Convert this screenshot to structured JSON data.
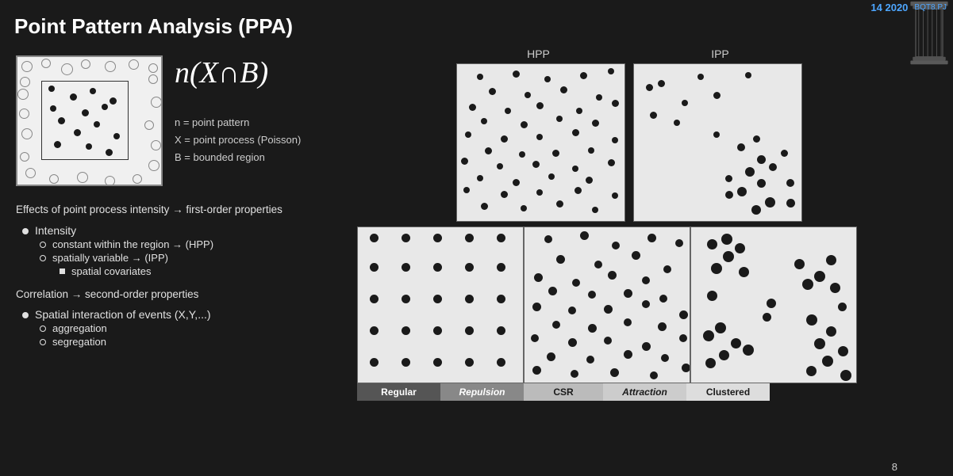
{
  "title": "Point Pattern Analysis (PPA)",
  "topbar": {
    "date": "14  2020",
    "subtitle": "BQT8.PJ"
  },
  "formula": {
    "text": "n(X∩B)",
    "definitions": [
      "n = point pattern",
      "X = point process (Poisson)",
      "B = bounded region"
    ]
  },
  "content": {
    "section1_heading": "Effects of point process intensity → first-order properties",
    "bullet1_label": "Intensity",
    "bullet1_sub1": "constant within the region → (HPP)",
    "bullet1_sub2": "spatially variable → (IPP)",
    "bullet1_sub2_sub1": "spatial covariates",
    "section2_heading": "Correlation → second-order properties",
    "bullet2_label": "Spatial interaction of events (X,Y,...)",
    "bullet2_sub1": "aggregation",
    "bullet2_sub2": "segregation"
  },
  "image_labels": {
    "hpp": "HPP",
    "ipp": "IPP"
  },
  "bottom_labels": [
    {
      "text": "Regular",
      "type": "dark"
    },
    {
      "text": "Repulsion",
      "type": "medium"
    },
    {
      "text": "CSR",
      "type": "light"
    },
    {
      "text": "Attraction",
      "type": "lighter"
    },
    {
      "text": "Clustered",
      "type": "lightest"
    }
  ],
  "page_number": "8"
}
